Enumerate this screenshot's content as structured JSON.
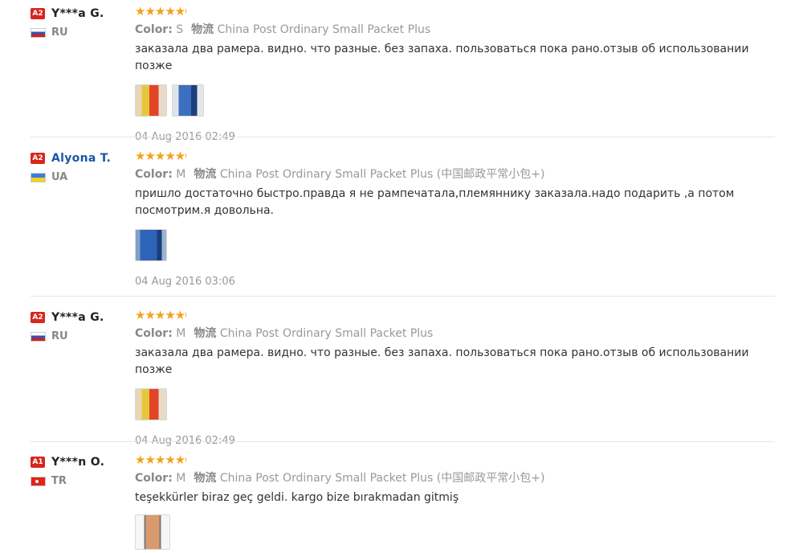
{
  "reviews": [
    {
      "level": "A2",
      "name": "Y***a G.",
      "country_code": "RU",
      "stars": "★★★★★",
      "star_tick": "ı",
      "color_label": "Color:",
      "color_value": "S",
      "shipping_label": "物流",
      "shipping_value": "China Post Ordinary Small Packet Plus",
      "text": "заказала два рамера. видно. что разные. без запаха. пользоваться пока рано.отзыв об использовании позже",
      "photos": 2,
      "date": "04 Aug 2016 02:49"
    },
    {
      "level": "A2",
      "name": "Alyona T.",
      "country_code": "UA",
      "stars": "★★★★★",
      "star_tick": "ı",
      "color_label": "Color:",
      "color_value": "M",
      "shipping_label": "物流",
      "shipping_value": "China Post Ordinary Small Packet Plus (中国邮政平常小包+)",
      "text": "пришло достаточно быстро.правда я не рампечатала,племяннику заказала.надо подарить ,а потом посмотрим.я довольна.",
      "photos": 1,
      "date": "04 Aug 2016 03:06"
    },
    {
      "level": "A2",
      "name": "Y***a G.",
      "country_code": "RU",
      "stars": "★★★★★",
      "star_tick": "ı",
      "color_label": "Color:",
      "color_value": "M",
      "shipping_label": "物流",
      "shipping_value": "China Post Ordinary Small Packet Plus",
      "text": "заказала два рамера. видно. что разные. без запаха. пользоваться пока рано.отзыв об использовании позже",
      "photos": 1,
      "date": "04 Aug 2016 02:49"
    },
    {
      "level": "A1",
      "name": "Y***n O.",
      "country_code": "TR",
      "stars": "★★★★★",
      "star_tick": "ı",
      "color_label": "Color:",
      "color_value": "M",
      "shipping_label": "物流",
      "shipping_value": "China Post Ordinary Small Packet Plus (中国邮政平常小包+)",
      "text": "teşekkürler biraz geç geldi. kargo bize bırakmadan gitmiş",
      "photos": 1,
      "date": ""
    }
  ]
}
